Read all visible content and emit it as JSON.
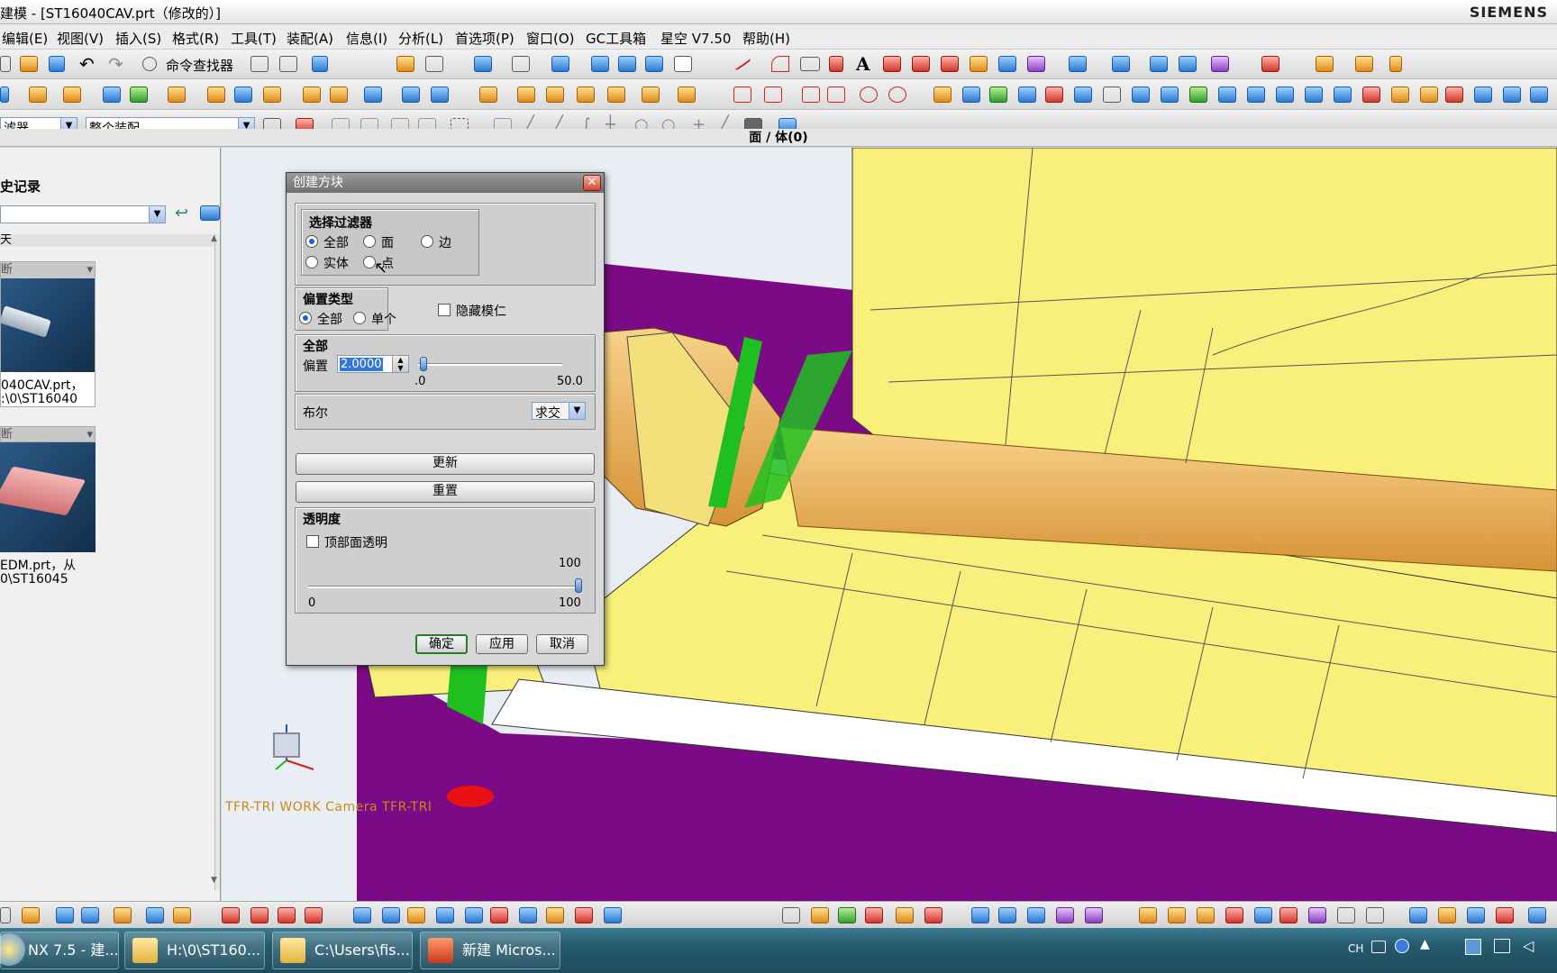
{
  "window": {
    "title": "建模 - [ST16040CAV.prt（修改的）]",
    "brand": "SIEMENS"
  },
  "menu": [
    "编辑(E)",
    "视图(V)",
    "插入(S)",
    "格式(R)",
    "工具(T)",
    "装配(A)",
    "信息(I)",
    "分析(L)",
    "首选项(P)",
    "窗口(O)",
    "GC工具箱",
    "星空 V7.50",
    "帮助(H)"
  ],
  "toolbar": {
    "command_finder": "命令查找器",
    "filter_select": "滤器",
    "assembly_select": "整个装配"
  },
  "status_title": "面 / 体(0)",
  "left_panel": {
    "header": "史记录",
    "day_label": "天",
    "items": [
      {
        "filter": "断",
        "name": "040CAV.prt，",
        "path": ":\\0\\ST16040"
      },
      {
        "filter": "断",
        "name": "EDM.prt，从",
        "path": "0\\ST16045"
      }
    ]
  },
  "viewport": {
    "camera_label": "TFR-TRI WORK Camera TFR-TRI"
  },
  "dialog": {
    "title": "创建方块",
    "select_filter": {
      "heading": "选择过滤器",
      "options": [
        "全部",
        "面",
        "边",
        "实体",
        "点"
      ],
      "selected": "全部"
    },
    "offset_type": {
      "heading": "偏置类型",
      "options": [
        "全部",
        "单个"
      ],
      "selected": "全部"
    },
    "hide_core": "隐藏模仁",
    "all_section": {
      "heading": "全部",
      "offset_label": "偏置",
      "offset_value": "2.0000",
      "slider_min": ".0",
      "slider_max": "50.0",
      "slider_fraction": 0.04
    },
    "boolean": {
      "label": "布尔",
      "value": "求交"
    },
    "update_button": "更新",
    "reset_button": "重置",
    "transparency": {
      "heading": "透明度",
      "top_transparent": "顶部面透明",
      "value": "100",
      "min": "0",
      "max": "100",
      "fraction": 1.0
    },
    "ok": "确定",
    "apply": "应用",
    "cancel": "取消"
  },
  "taskbar": {
    "items": [
      "NX 7.5 - 建...",
      "H:\\0\\ST160...",
      "C:\\Users\\fis...",
      "新建 Micros..."
    ],
    "tray_lang": "CH"
  },
  "colors": {
    "part_yellow": "#f8f07a",
    "part_purple": "#7a0a86",
    "highlight_green": "#1fbf1f",
    "core_orange": "#f2b24a"
  }
}
